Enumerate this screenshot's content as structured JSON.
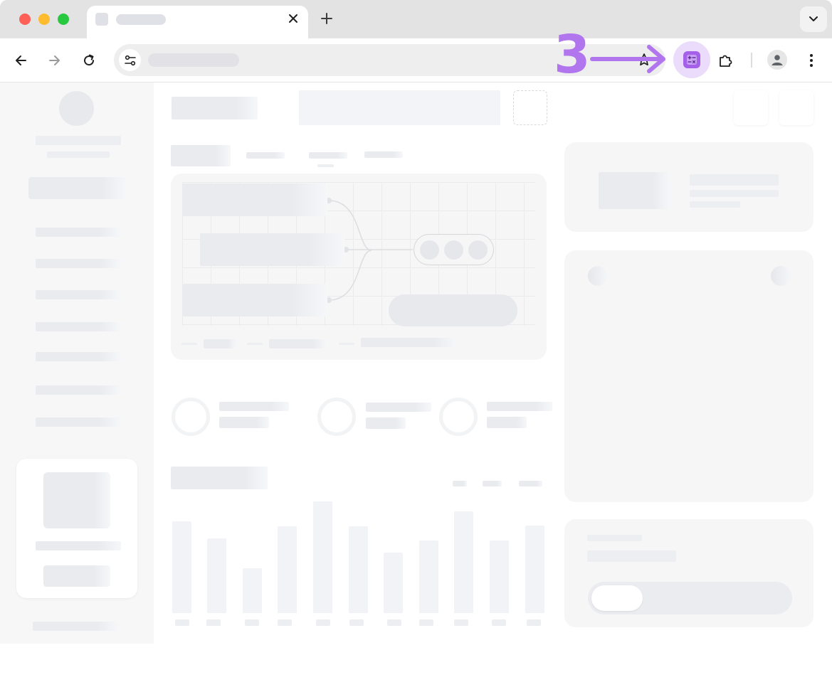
{
  "annotation": {
    "step_number": "3",
    "color": "#b176ee",
    "highlight_color": "#ecdcfb"
  },
  "browser": {
    "traffic_lights": [
      "#fe5f57",
      "#febc2e",
      "#28c840"
    ],
    "toolbar_icons": [
      "back-icon",
      "forward-icon",
      "reload-icon",
      "tune-icon",
      "star-icon",
      "calculator-extension-icon",
      "puzzle-icon",
      "profile-icon",
      "kebab-menu-icon"
    ]
  }
}
